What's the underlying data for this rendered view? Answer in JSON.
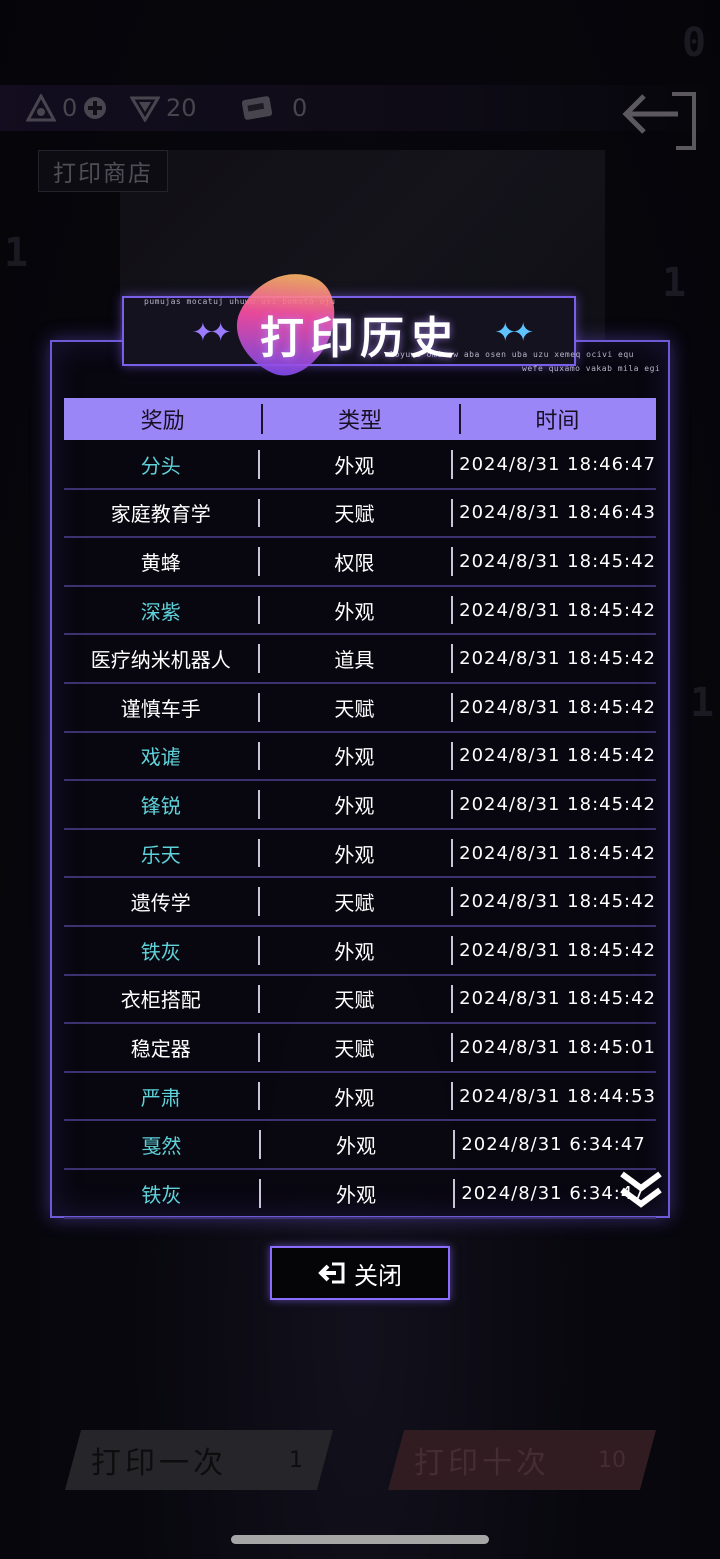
{
  "topbar": {
    "res1_value": "0",
    "res2_value": "20",
    "res3_value": "0",
    "shop_label": "打印商店"
  },
  "dialog": {
    "title": "打印历史",
    "deco_line1": "pumujas mocatuj uhuwu usi bomoto oju",
    "deco_line2": "loyuwe omimow aba osen uba uzu xemeq ocivi equ",
    "deco_line3": "wefe quxamo vakab mila egi",
    "columns": [
      "奖励",
      "类型",
      "时间"
    ],
    "rows": [
      {
        "reward": "分头",
        "type": "外观",
        "time": "2024/8/31 18:46:47",
        "rare": true
      },
      {
        "reward": "家庭教育学",
        "type": "天赋",
        "time": "2024/8/31 18:46:43",
        "rare": false
      },
      {
        "reward": "黄蜂",
        "type": "权限",
        "time": "2024/8/31 18:45:42",
        "rare": false
      },
      {
        "reward": "深紫",
        "type": "外观",
        "time": "2024/8/31 18:45:42",
        "rare": true
      },
      {
        "reward": "医疗纳米机器人",
        "type": "道具",
        "time": "2024/8/31 18:45:42",
        "rare": false
      },
      {
        "reward": "谨慎车手",
        "type": "天赋",
        "time": "2024/8/31 18:45:42",
        "rare": false
      },
      {
        "reward": "戏谑",
        "type": "外观",
        "time": "2024/8/31 18:45:42",
        "rare": true
      },
      {
        "reward": "锋锐",
        "type": "外观",
        "time": "2024/8/31 18:45:42",
        "rare": true
      },
      {
        "reward": "乐天",
        "type": "外观",
        "time": "2024/8/31 18:45:42",
        "rare": true
      },
      {
        "reward": "遗传学",
        "type": "天赋",
        "time": "2024/8/31 18:45:42",
        "rare": false
      },
      {
        "reward": "铁灰",
        "type": "外观",
        "time": "2024/8/31 18:45:42",
        "rare": true
      },
      {
        "reward": "衣柜搭配",
        "type": "天赋",
        "time": "2024/8/31 18:45:42",
        "rare": false
      },
      {
        "reward": "稳定器",
        "type": "天赋",
        "time": "2024/8/31 18:45:01",
        "rare": false
      },
      {
        "reward": "严肃",
        "type": "外观",
        "time": "2024/8/31 18:44:53",
        "rare": true
      },
      {
        "reward": "戛然",
        "type": "外观",
        "time": "2024/8/31 6:34:47",
        "rare": true
      },
      {
        "reward": "铁灰",
        "type": "外观",
        "time": "2024/8/31 6:34:47",
        "rare": true
      }
    ],
    "close_label": "关闭"
  },
  "footer": {
    "print_once_label": "打印一次",
    "print_once_cost": "1",
    "print_ten_label": "打印十次",
    "print_ten_cost": "10"
  },
  "colors": {
    "accent": "#9b86f7",
    "border": "#6f5ad6",
    "rare_text": "#5fd2da"
  }
}
